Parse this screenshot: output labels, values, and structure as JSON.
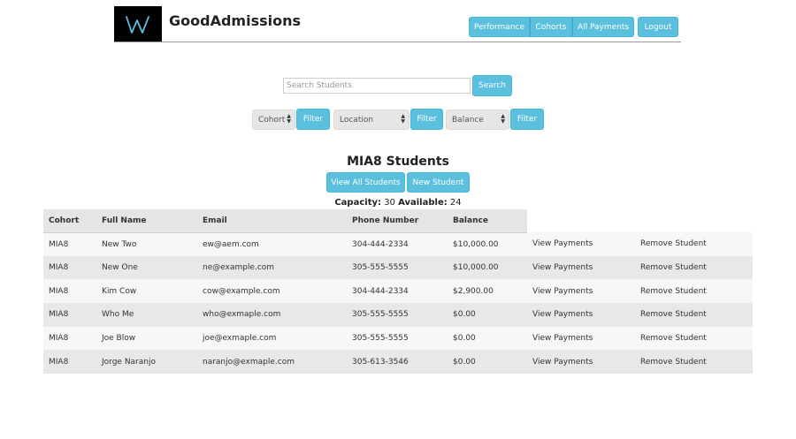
{
  "app": {
    "title": "GoodAdmissions",
    "logo_letter": "W"
  },
  "nav": {
    "items": [
      {
        "label": "Performance"
      },
      {
        "label": "Cohorts"
      },
      {
        "label": "All Payments"
      }
    ],
    "logout_label": "Logout"
  },
  "search": {
    "placeholder": "Search Students",
    "button_label": "Search"
  },
  "filters": [
    {
      "selected": "Cohort",
      "button_label": "Filter"
    },
    {
      "selected": "Location",
      "button_label": "Filter"
    },
    {
      "selected": "Balance",
      "button_label": "Filter"
    }
  ],
  "section": {
    "title": "MIA8 Students",
    "view_all_label": "View All Students",
    "new_student_label": "New Student",
    "capacity_label": "Capacity:",
    "capacity_value": "30",
    "available_label": "Available:",
    "available_value": "24"
  },
  "table": {
    "headers": [
      "Cohort",
      "Full Name",
      "Email",
      "Phone Number",
      "Balance",
      "",
      ""
    ],
    "rows": [
      {
        "cohort": "MIA8",
        "name": "New Two",
        "email": "ew@aem.com",
        "phone": "304-444-2334",
        "balance": "$10,000.00",
        "view": "View Payments",
        "remove": "Remove Student"
      },
      {
        "cohort": "MIA8",
        "name": "New One",
        "email": "ne@example.com",
        "phone": "305-555-5555",
        "balance": "$10,000.00",
        "view": "View Payments",
        "remove": "Remove Student"
      },
      {
        "cohort": "MIA8",
        "name": "Kim Cow",
        "email": "cow@example.com",
        "phone": "304-444-2334",
        "balance": "$2,900.00",
        "view": "View Payments",
        "remove": "Remove Student"
      },
      {
        "cohort": "MIA8",
        "name": "Who Me",
        "email": "who@exmaple.com",
        "phone": "305-555-5555",
        "balance": "$0.00",
        "view": "View Payments",
        "remove": "Remove Student"
      },
      {
        "cohort": "MIA8",
        "name": "Joe Blow",
        "email": "joe@exmaple.com",
        "phone": "305-555-5555",
        "balance": "$0.00",
        "view": "View Payments",
        "remove": "Remove Student"
      },
      {
        "cohort": "MIA8",
        "name": "Jorge Naranjo",
        "email": "naranjo@exmaple.com",
        "phone": "305-613-3546",
        "balance": "$0.00",
        "view": "View Payments",
        "remove": "Remove Student"
      }
    ]
  },
  "colors": {
    "accent": "#5bc0de",
    "balance_owed": "#f0ad4e",
    "balance_paid": "#5bc0de"
  }
}
